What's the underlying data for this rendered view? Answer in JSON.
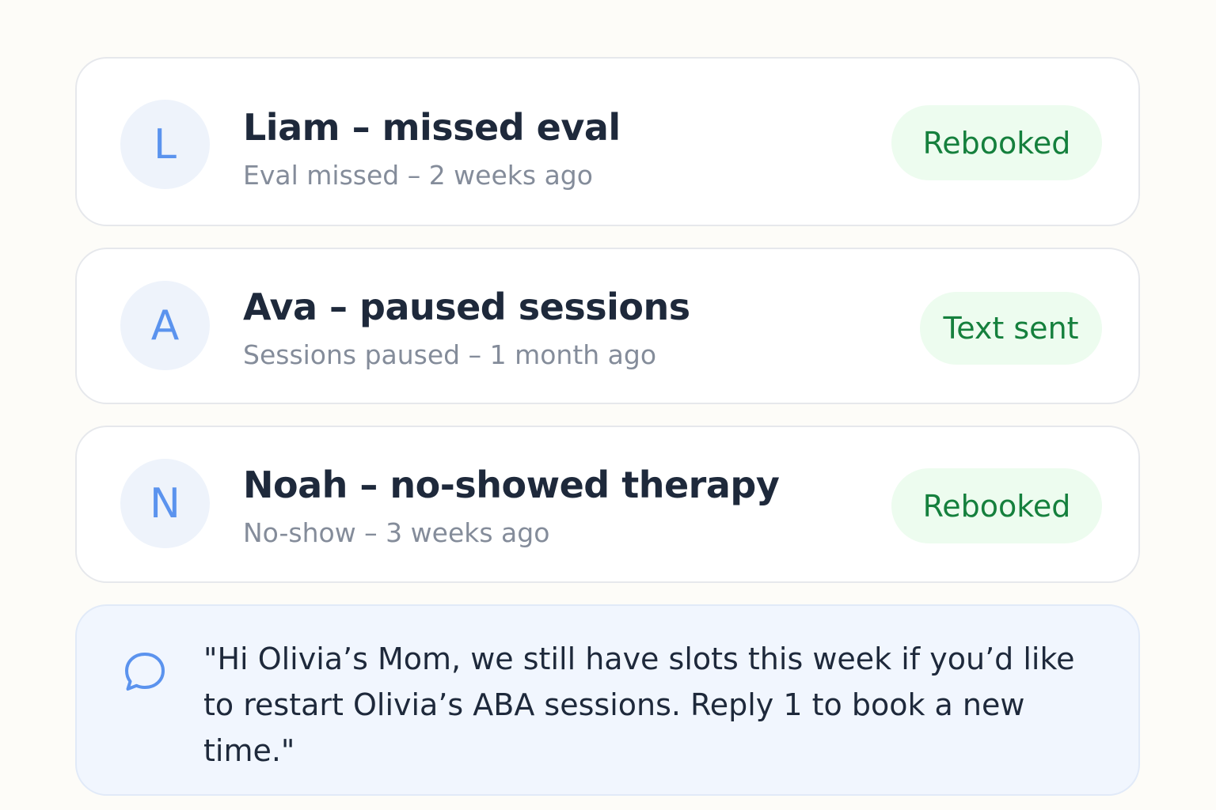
{
  "items": [
    {
      "initial": "L",
      "title": "Liam – missed eval",
      "subtitle": "Eval missed – 2 weeks ago",
      "status": "Rebooked"
    },
    {
      "initial": "A",
      "title": "Ava – paused sessions",
      "subtitle": "Sessions paused – 1 month ago",
      "status": "Text sent"
    },
    {
      "initial": "N",
      "title": "Noah – no-showed therapy",
      "subtitle": "No-show – 3 weeks ago",
      "status": "Rebooked"
    }
  ],
  "message": {
    "icon": "chat-bubble-icon",
    "text": "\"Hi Olivia’s Mom, we still have slots this week if you’d like to restart Olivia’s ABA sessions. Reply 1 to book a new time.\""
  },
  "colors": {
    "avatar_bg": "#eef3fb",
    "avatar_text": "#5b93ee",
    "title": "#1e293b",
    "subtitle": "#848c9a",
    "badge_bg": "#edfcef",
    "badge_text": "#15803d",
    "message_bg": "#f1f6fe"
  }
}
